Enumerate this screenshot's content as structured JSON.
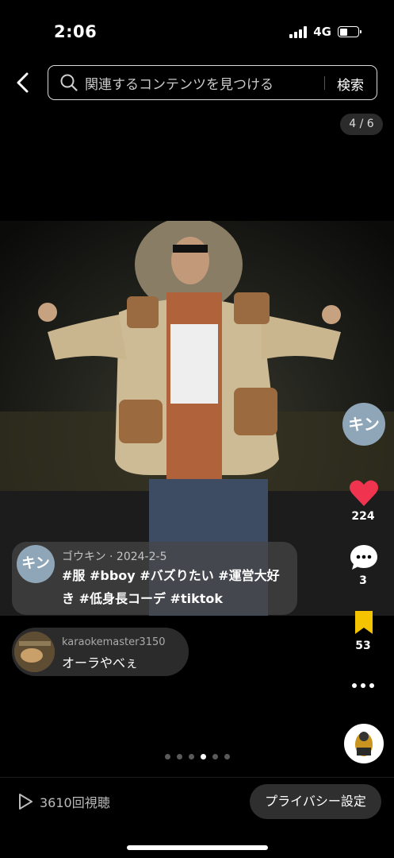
{
  "status": {
    "time": "2:06",
    "network": "4G"
  },
  "header": {
    "search_placeholder": "関連するコンテンツを見つける",
    "search_button": "検索"
  },
  "post": {
    "counter": "4 / 6",
    "author_avatar_text": "キン",
    "meta": "ゴウキン · 2024-2-5",
    "caption": "#服 #bboy #バズりたい #運営大好き #低身長コーデ #tiktok"
  },
  "comment": {
    "user": "karaokemaster3150",
    "text": "オーラやべぇ"
  },
  "actions": {
    "likes": "224",
    "comments": "3",
    "saves": "53",
    "like_color": "#f0344f",
    "save_color": "#f5c400"
  },
  "pager": {
    "pages": 6,
    "active_index": 3
  },
  "footer": {
    "views": "3610回視聴",
    "privacy_button": "プライバシー設定"
  }
}
